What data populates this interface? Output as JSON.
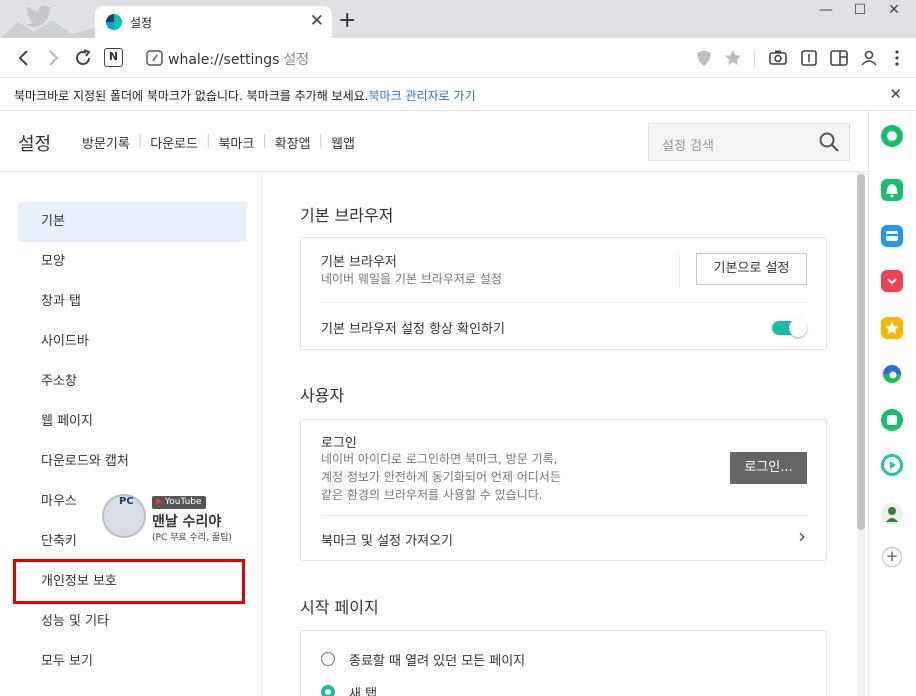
{
  "tab": {
    "title": "설정",
    "close": "✕",
    "new": "+"
  },
  "window": {
    "minimize": "—",
    "maximize": "☐",
    "close": "✕"
  },
  "toolbar": {
    "url": "whale://settings",
    "url_sub": "설정",
    "reader_label": "N"
  },
  "bookmark_bar": {
    "message": "북마크바로 지정된 폴더에 북마크가 없습니다. 북마크를 추가해 보세요.",
    "link": "북마크 관리자로 가기",
    "close": "✕"
  },
  "header": {
    "title": "설정",
    "nav": [
      "방문기록",
      "다운로드",
      "북마크",
      "확장앱",
      "웹앱"
    ],
    "search_placeholder": "설정 검색"
  },
  "sidebar": {
    "items": [
      {
        "label": "기본",
        "active": true
      },
      {
        "label": "모양"
      },
      {
        "label": "창과 탭"
      },
      {
        "label": "사이드바"
      },
      {
        "label": "주소창"
      },
      {
        "label": "웹 페이지"
      },
      {
        "label": "다운로드와 캡처"
      },
      {
        "label": "마우스"
      },
      {
        "label": "단축키"
      },
      {
        "label": "개인정보 보호"
      },
      {
        "label": "성능 및 기타"
      },
      {
        "label": "모두 보기"
      }
    ]
  },
  "sections": {
    "default_browser": {
      "title": "기본 브라우저",
      "row_label": "기본 브라우저",
      "row_desc": "네이버 웨일을 기본 브라우저로 설정",
      "button": "기본으로 설정",
      "check_label": "기본 브라우저 설정 항상 확인하기",
      "check_on": true
    },
    "user": {
      "title": "사용자",
      "login_label": "로그인",
      "login_desc": [
        "네이버 아이디로 로그인하면 북마크, 방문 기록,",
        "계정 정보가 안전하게 동기화되어 언제 어디서든",
        "같은 환경의 브라우저를 사용할 수 있습니다."
      ],
      "login_button": "로그인...",
      "import_label": "북마크 및 설정 가져오기",
      "import_chevron": "›"
    },
    "startup": {
      "title": "시작 페이지",
      "options": [
        {
          "label": "종료할 때 열려 있던 모든 페이지",
          "selected": false
        },
        {
          "label": "새 탭",
          "selected": true
        }
      ]
    }
  },
  "watermark": {
    "badge": "PC",
    "youtube": "YouTube",
    "name": "맨날 수리야",
    "sub": "(PC 무료 수리, 꿀팁)"
  },
  "right_sidebar": {
    "icons": [
      {
        "name": "whale-icon",
        "color": "#16c06a"
      },
      {
        "name": "alarm-icon",
        "color": "#16c06a"
      },
      {
        "name": "wallet-icon",
        "color": "#2196f3"
      },
      {
        "name": "pocket-icon",
        "color": "#ef4056"
      },
      {
        "name": "star-icon",
        "color": "#f5b800"
      },
      {
        "name": "edge-icon",
        "color": "#1db954"
      },
      {
        "name": "square-icon",
        "color": "#16c06a"
      },
      {
        "name": "play-icon",
        "color": "#1ec8a5"
      },
      {
        "name": "avatar-icon",
        "color": "#3a7d44"
      }
    ],
    "add": "+"
  },
  "colors": {
    "accent": "#16c0a0",
    "link": "#2f6fd6",
    "highlight_box": "#e00000",
    "active_nav_bg": "#e8f0f9"
  }
}
